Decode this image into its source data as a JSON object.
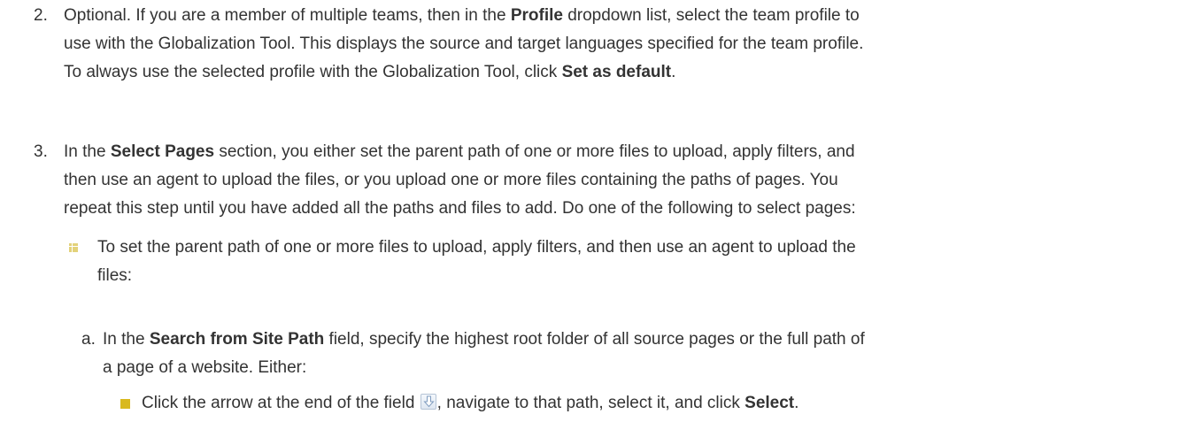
{
  "step2": {
    "number": "2.",
    "line1_a": "Optional. If you are a member of multiple teams, then in the ",
    "line1_b": "Profile",
    "line1_c": " dropdown list, select the team profile to",
    "line2": "use with the Globalization Tool. This displays the source and target languages specified for the team profile.",
    "line3_a": "To always use the selected profile with the Globalization Tool, click ",
    "line3_b": "Set as default",
    "line3_c": "."
  },
  "step3": {
    "number": "3.",
    "line1_a": "In the ",
    "line1_b": "Select Pages",
    "line1_c": " section, you either set the parent path of one or more files to upload, apply filters, and",
    "line2": "then use an agent to upload the files, or you upload one or more files containing the paths of pages. You",
    "line3": "repeat this step until you have added all the paths and files to add. Do one of the following to select pages:"
  },
  "bullet1": {
    "line1": "To set the parent path of one or more files to upload, apply filters, and then use an agent to upload the",
    "line2": "files:"
  },
  "sub_a": {
    "label": "a.",
    "line1_a": "In the ",
    "line1_b": "Search from Site Path",
    "line1_c": " field, specify the highest root folder of all source pages or the full path of",
    "line2": "a page of a website. Either:"
  },
  "sub_bullet1": {
    "text_a": "Click the arrow at the end of the field ",
    "text_b": ", navigate to that path, select it, and click ",
    "text_c": "Select",
    "text_d": "."
  },
  "colors": {
    "text": "#333333",
    "grid_bullet": "#e3d27a",
    "square_bullet": "#d9b91e"
  },
  "icons": {
    "field_arrow": "down-arrow-icon"
  }
}
